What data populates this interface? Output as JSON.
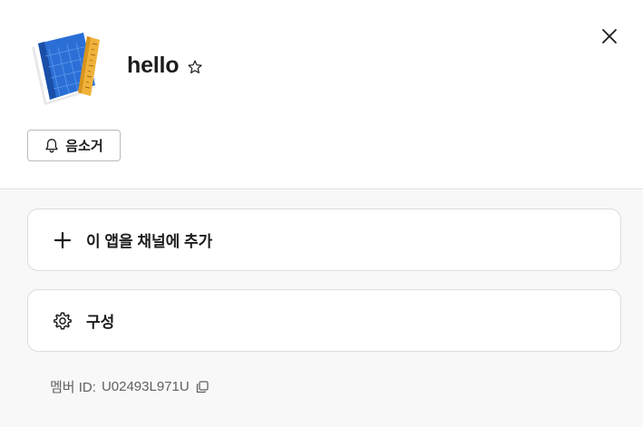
{
  "header": {
    "app_name": "hello",
    "mute_label": "음소거"
  },
  "actions": {
    "add_to_channel_label": "이 앱을 채널에 추가",
    "configure_label": "구성"
  },
  "footer": {
    "member_id_label": "멤버 ID:",
    "member_id_value": "U02493L971U"
  },
  "icons": {
    "close": "close-icon",
    "star": "star-icon",
    "bell": "bell-icon",
    "plus": "plus-icon",
    "gear": "gear-icon",
    "copy": "copy-icon",
    "app": "blueprint-book-icon"
  },
  "colors": {
    "app_icon_blue": "#2b6fd6",
    "app_icon_ruler": "#f0b23a",
    "divider": "#dddddd",
    "muted_text": "#616061"
  }
}
